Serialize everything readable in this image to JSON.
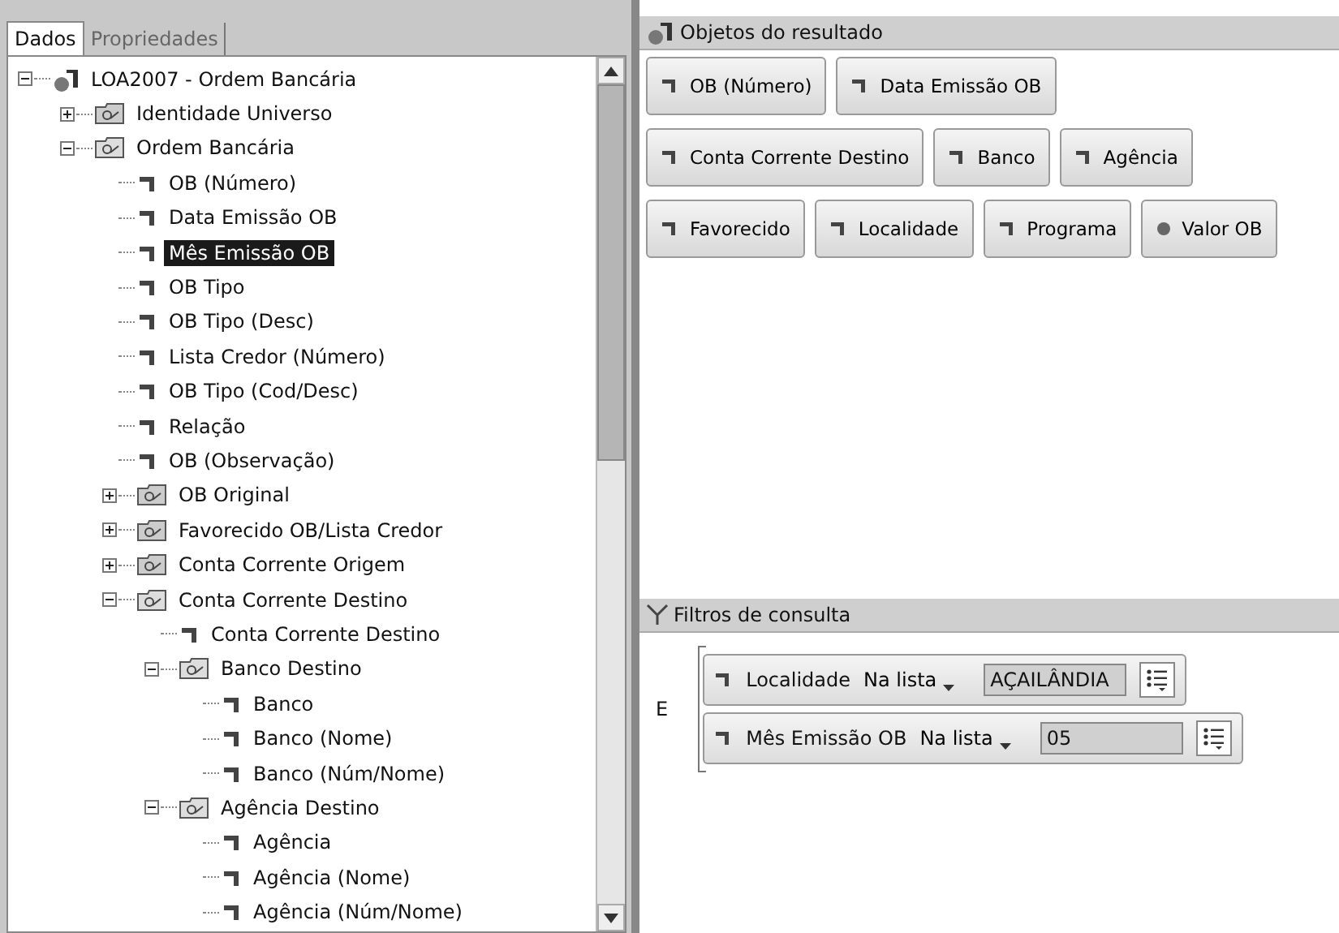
{
  "tabs": [
    {
      "label": "Dados",
      "selected": true
    },
    {
      "label": "Propriedades",
      "selected": false
    }
  ],
  "tree": [
    {
      "label": "LOA2007 - Ordem Bancária",
      "kind": "universe",
      "expanded": true,
      "children": [
        {
          "label": "Identidade Universo",
          "kind": "folder",
          "expanded": false
        },
        {
          "label": "Ordem Bancária",
          "kind": "folder",
          "expanded": true,
          "children": [
            {
              "label": "OB (Número)",
              "kind": "object",
              "selected": false
            },
            {
              "label": "Data Emissão OB",
              "kind": "object",
              "selected": false
            },
            {
              "label": "Mês Emissão OB",
              "kind": "object",
              "selected": true
            },
            {
              "label": "OB Tipo",
              "kind": "object",
              "selected": false
            },
            {
              "label": "OB Tipo (Desc)",
              "kind": "object",
              "selected": false
            },
            {
              "label": "Lista Credor (Número)",
              "kind": "object",
              "selected": false
            },
            {
              "label": "OB Tipo (Cod/Desc)",
              "kind": "object",
              "selected": false
            },
            {
              "label": "Relação",
              "kind": "object",
              "selected": false
            },
            {
              "label": "OB (Observação)",
              "kind": "object",
              "selected": false
            },
            {
              "label": "OB Original",
              "kind": "folder",
              "expanded": false
            },
            {
              "label": "Favorecido OB/Lista Credor",
              "kind": "folder",
              "expanded": false
            },
            {
              "label": "Conta Corrente Origem",
              "kind": "folder",
              "expanded": false
            },
            {
              "label": "Conta Corrente Destino",
              "kind": "folder",
              "expanded": true,
              "children": [
                {
                  "label": "Conta Corrente Destino",
                  "kind": "object",
                  "selected": false
                },
                {
                  "label": "Banco Destino",
                  "kind": "folder",
                  "expanded": true,
                  "children": [
                    {
                      "label": "Banco",
                      "kind": "object",
                      "selected": false
                    },
                    {
                      "label": "Banco (Nome)",
                      "kind": "object",
                      "selected": false
                    },
                    {
                      "label": "Banco (Núm/Nome)",
                      "kind": "object",
                      "selected": false
                    }
                  ]
                },
                {
                  "label": "Agência Destino",
                  "kind": "folder",
                  "expanded": true,
                  "children": [
                    {
                      "label": "Agência",
                      "kind": "object",
                      "selected": false
                    },
                    {
                      "label": "Agência (Nome)",
                      "kind": "object",
                      "selected": false
                    },
                    {
                      "label": "Agência (Núm/Nome)",
                      "kind": "object",
                      "selected": false
                    }
                  ]
                }
              ]
            }
          ]
        }
      ]
    }
  ],
  "result_objects": {
    "title": "Objetos do resultado",
    "rows": [
      [
        {
          "label": "OB (Número)",
          "kind": "dimension"
        },
        {
          "label": "Data Emissão OB",
          "kind": "dimension"
        }
      ],
      [
        {
          "label": "Conta Corrente Destino",
          "kind": "dimension"
        },
        {
          "label": "Banco",
          "kind": "dimension"
        },
        {
          "label": "Agência",
          "kind": "dimension"
        }
      ],
      [
        {
          "label": "Favorecido",
          "kind": "dimension"
        },
        {
          "label": "Localidade",
          "kind": "dimension"
        },
        {
          "label": "Programa",
          "kind": "dimension"
        },
        {
          "label": "Valor OB",
          "kind": "measure"
        }
      ]
    ]
  },
  "query_filters": {
    "title": "Filtros de consulta",
    "operator": "E",
    "filters": [
      {
        "object": "Localidade",
        "operator": "Na lista",
        "value": "AÇAILÂNDIA"
      },
      {
        "object": "Mês Emissão OB",
        "operator": "Na lista",
        "value": "05"
      }
    ]
  }
}
